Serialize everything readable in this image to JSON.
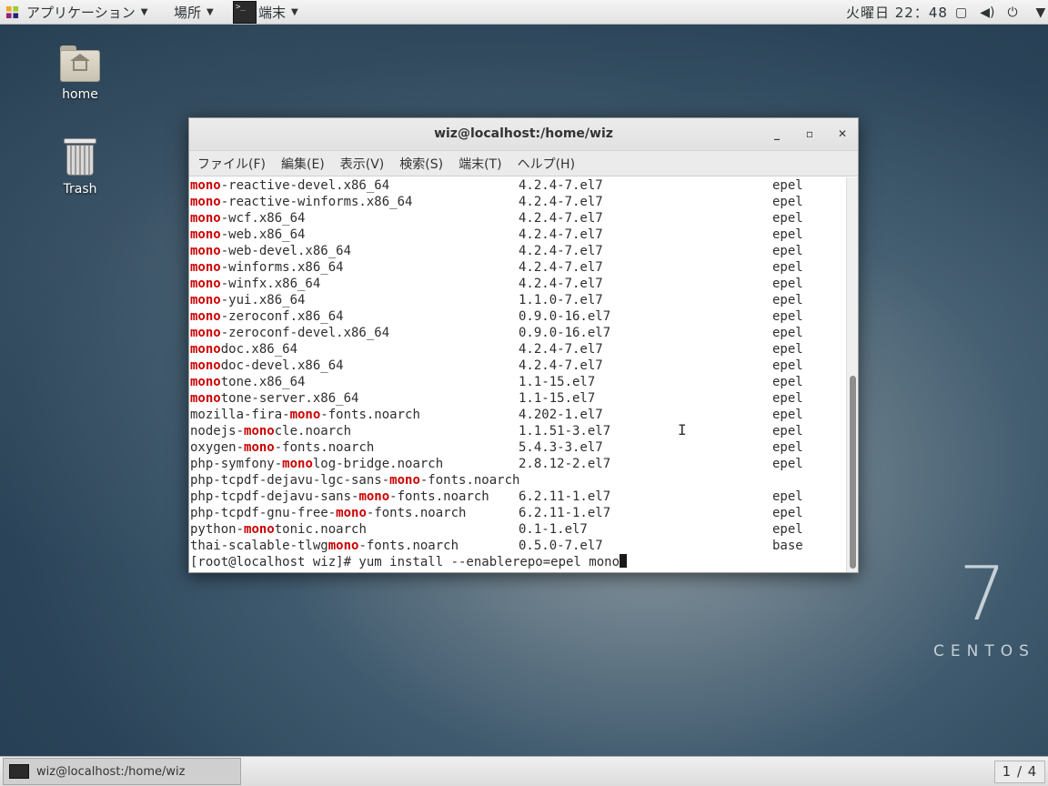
{
  "topbar": {
    "apps_label": "アプリケーション",
    "places_label": "場所",
    "terminal_label": "端末",
    "terminal_icon_text": ">_",
    "clock": "火曜日 22：48",
    "icons": [
      "screen-icon",
      "volume-icon",
      "power-icon"
    ]
  },
  "desktop": {
    "home_label": "home",
    "trash_label": "Trash"
  },
  "window": {
    "title": "wiz@localhost:/home/wiz",
    "menus": [
      "ファイル(F)",
      "編集(E)",
      "表示(V)",
      "検索(S)",
      "端末(T)",
      "ヘルプ(H)"
    ]
  },
  "terminal": {
    "rows": [
      {
        "pre": "",
        "hl": "mono",
        "post": "-reactive-devel.x86_64",
        "ver": "4.2.4-7.el7",
        "repo": "epel"
      },
      {
        "pre": "",
        "hl": "mono",
        "post": "-reactive-winforms.x86_64",
        "ver": "4.2.4-7.el7",
        "repo": "epel"
      },
      {
        "pre": "",
        "hl": "mono",
        "post": "-wcf.x86_64",
        "ver": "4.2.4-7.el7",
        "repo": "epel"
      },
      {
        "pre": "",
        "hl": "mono",
        "post": "-web.x86_64",
        "ver": "4.2.4-7.el7",
        "repo": "epel"
      },
      {
        "pre": "",
        "hl": "mono",
        "post": "-web-devel.x86_64",
        "ver": "4.2.4-7.el7",
        "repo": "epel"
      },
      {
        "pre": "",
        "hl": "mono",
        "post": "-winforms.x86_64",
        "ver": "4.2.4-7.el7",
        "repo": "epel"
      },
      {
        "pre": "",
        "hl": "mono",
        "post": "-winfx.x86_64",
        "ver": "4.2.4-7.el7",
        "repo": "epel"
      },
      {
        "pre": "",
        "hl": "mono",
        "post": "-yui.x86_64",
        "ver": "1.1.0-7.el7",
        "repo": "epel"
      },
      {
        "pre": "",
        "hl": "mono",
        "post": "-zeroconf.x86_64",
        "ver": "0.9.0-16.el7",
        "repo": "epel"
      },
      {
        "pre": "",
        "hl": "mono",
        "post": "-zeroconf-devel.x86_64",
        "ver": "0.9.0-16.el7",
        "repo": "epel"
      },
      {
        "pre": "",
        "hl": "mono",
        "post": "doc.x86_64",
        "ver": "4.2.4-7.el7",
        "repo": "epel"
      },
      {
        "pre": "",
        "hl": "mono",
        "post": "doc-devel.x86_64",
        "ver": "4.2.4-7.el7",
        "repo": "epel"
      },
      {
        "pre": "",
        "hl": "mono",
        "post": "tone.x86_64",
        "ver": "1.1-15.el7",
        "repo": "epel"
      },
      {
        "pre": "",
        "hl": "mono",
        "post": "tone-server.x86_64",
        "ver": "1.1-15.el7",
        "repo": "epel"
      },
      {
        "pre": "mozilla-fira-",
        "hl": "mono",
        "post": "-fonts.noarch",
        "ver": "4.202-1.el7",
        "repo": "epel"
      },
      {
        "pre": "nodejs-",
        "hl": "mono",
        "post": "cle.noarch",
        "ver": "1.1.51-3.el7",
        "repo": "epel"
      },
      {
        "pre": "oxygen-",
        "hl": "mono",
        "post": "-fonts.noarch",
        "ver": "5.4.3-3.el7",
        "repo": "epel"
      },
      {
        "pre": "php-symfony-",
        "hl": "mono",
        "post": "log-bridge.noarch",
        "ver": "2.8.12-2.el7",
        "repo": "epel"
      },
      {
        "pre": "php-tcpdf-dejavu-lgc-sans-",
        "hl": "mono",
        "post": "-fonts.noarch",
        "ver": "",
        "repo": ""
      },
      {
        "pre": "php-tcpdf-dejavu-sans-",
        "hl": "mono",
        "post": "-fonts.noarch",
        "ver": "6.2.11-1.el7",
        "repo": "epel"
      },
      {
        "pre": "php-tcpdf-gnu-free-",
        "hl": "mono",
        "post": "-fonts.noarch",
        "ver": "6.2.11-1.el7",
        "repo": "epel"
      },
      {
        "pre": "python-",
        "hl": "mono",
        "post": "tonic.noarch",
        "ver": "0.1-1.el7",
        "repo": "epel"
      },
      {
        "pre": "thai-scalable-tlwg",
        "hl": "mono",
        "post": "-fonts.noarch",
        "ver": "0.5.0-7.el7",
        "repo": "base"
      }
    ],
    "prompt": "[root@localhost wiz]# yum install --enablerepo=epel mono",
    "highlight_color": "#cc0000"
  },
  "brand": {
    "version": "7",
    "name": "CENTOS"
  },
  "taskbar": {
    "task_label": "wiz@localhost:/home/wiz",
    "workspace": "1 / 4"
  }
}
